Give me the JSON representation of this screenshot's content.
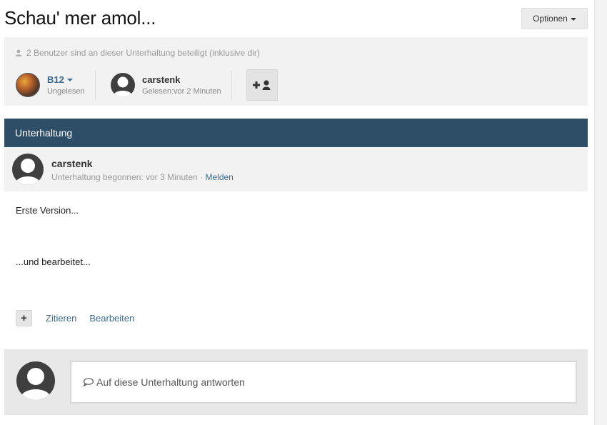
{
  "page": {
    "title": "Schau' mer amol...",
    "options_label": "Optionen"
  },
  "participants": {
    "info": "2 Benutzer sind an dieser Unterhaltung beteiligt (inklusive dir)",
    "users": [
      {
        "name": "B12",
        "status": "Ungelesen"
      },
      {
        "name": "carstenk",
        "status": "Gelesen:vor 2 Minuten"
      }
    ]
  },
  "section": {
    "title": "Unterhaltung"
  },
  "post": {
    "author": "carstenk",
    "meta": "Unterhaltung begonnen: vor 3 Minuten · ",
    "report_label": "Melden",
    "body_line1": "Erste Version...",
    "body_line2": "...und bearbeitet...",
    "plus_label": "+",
    "quote_label": "Zitieren",
    "edit_label": "Bearbeiten"
  },
  "reply": {
    "placeholder": "Auf diese Unterhaltung antworten"
  },
  "colors": {
    "header_bg": "#2e4d66",
    "link": "#3d6a8f"
  },
  "icons": [
    "user-icon",
    "caret-down-icon",
    "add-user-icon",
    "plus-icon",
    "comment-bubble-icon"
  ]
}
